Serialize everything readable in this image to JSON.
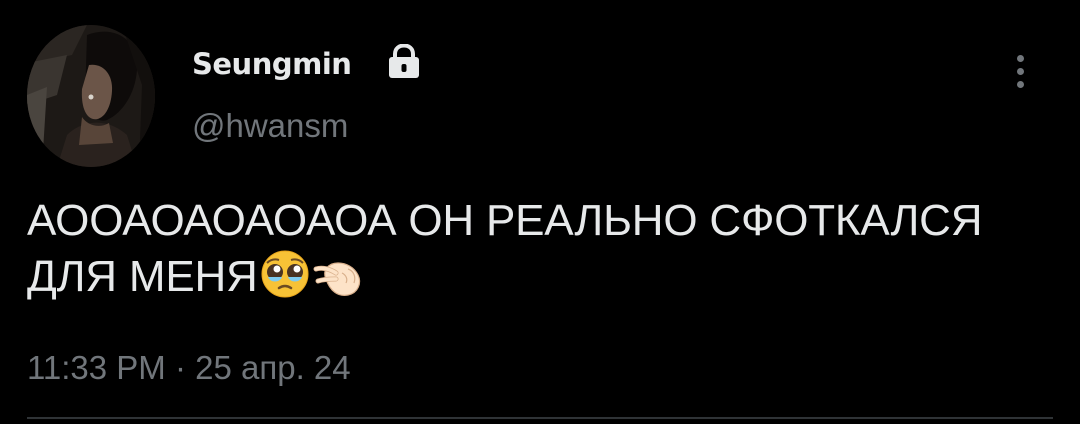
{
  "tweet": {
    "author": {
      "display_name": "Seungmin",
      "handle": "@hwansm",
      "protected_icon": "lock-icon"
    },
    "text_line_1": "АООАОАОАОАОА ОН РЕАЛЬНО СФОТКАЛСЯ",
    "text_line_2": "ДЛЯ МЕНЯ",
    "emojis": [
      "pleading-face",
      "pinching-hand"
    ],
    "timestamp": "11:33 PM · 25 апр. 24",
    "more_icon": "more-vertical-icon"
  },
  "colors": {
    "background": "#000000",
    "primary_text": "#e7e9ea",
    "secondary_text": "#71767b",
    "divider": "#2f3336"
  }
}
